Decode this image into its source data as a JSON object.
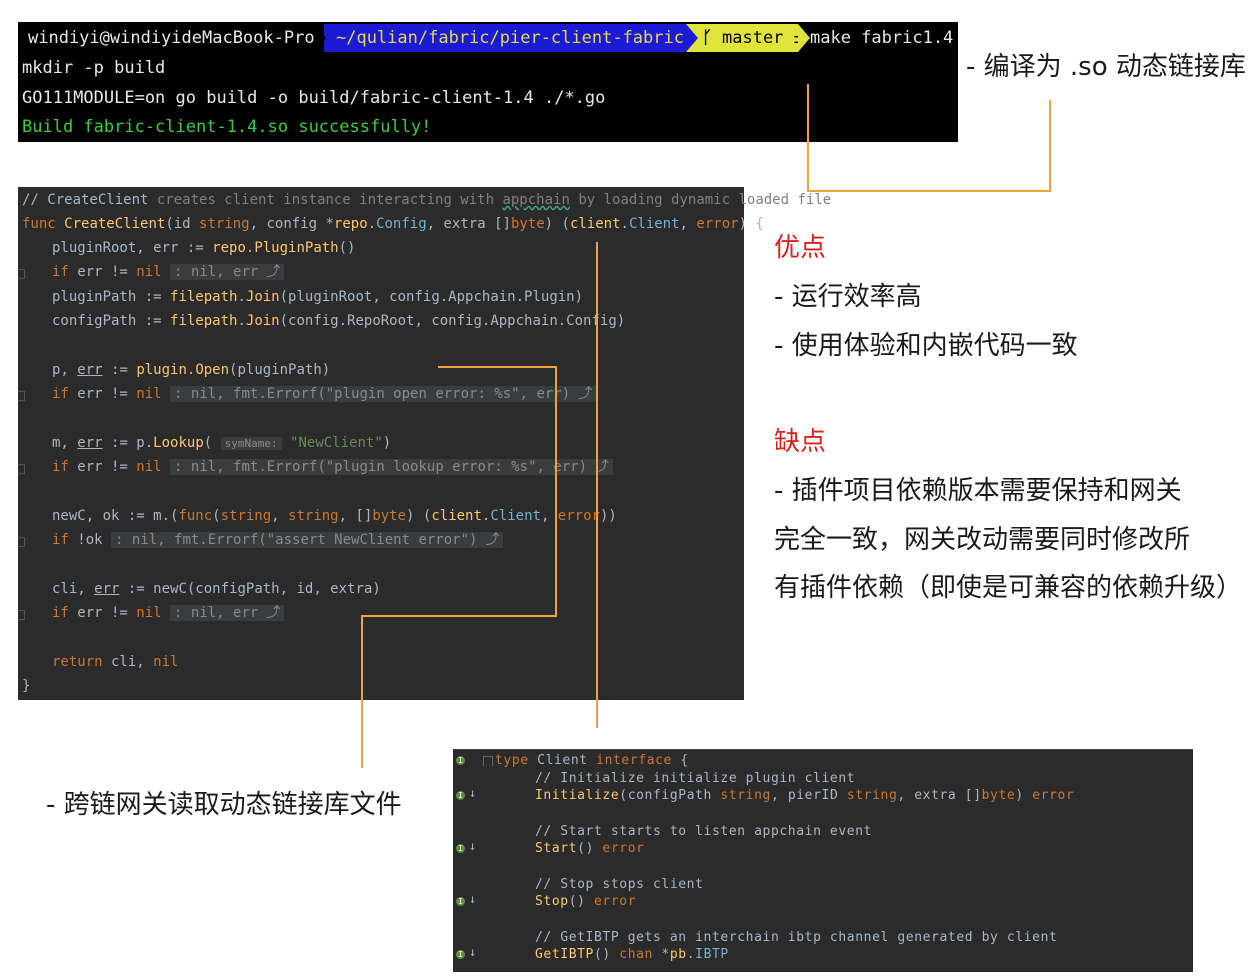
{
  "terminal": {
    "prompt_user": "windiyi@windiyideMacBook-Pro",
    "prompt_path": "~/qulian/fabric/pier-client-fabric",
    "git_branch": "master ±",
    "command": "make fabric1.4",
    "lines": [
      "mkdir -p build",
      "GO111MODULE=on go build -o build/fabric-client-1.4 ./*.go",
      "Build fabric-client-1.4.so successfully!"
    ]
  },
  "ide": {
    "comment_head": "// CreateClient",
    "comment_tail": " creates client instance interacting with ",
    "comment_appchain": "appchain",
    "comment_end": " by loading dynamic loaded file",
    "func_kw": "func ",
    "func_name": "CreateClient",
    "sig": [
      "(id ",
      "string",
      ", config *",
      "repo",
      ".",
      "Config",
      ", extra []",
      "byte",
      ") (",
      "client",
      ".",
      "Client",
      ", ",
      "error",
      ") {"
    ],
    "l_pluginroot": [
      "pluginRoot, err := ",
      "repo",
      ".",
      "PluginPath",
      "()"
    ],
    "l_if": [
      "if",
      " err != ",
      "nil"
    ],
    "l_ifnot": [
      "if",
      " !ok"
    ],
    "hint_nil_err": ": nil, err",
    "hint_open": ": nil, fmt.Errorf(\"plugin open error: %s\", err)",
    "hint_lookup": ": nil, fmt.Errorf(\"plugin lookup error: %s\", err)",
    "hint_assert": ": nil, fmt.Errorf(\"assert NewClient error\")",
    "l_pluginpath": [
      "pluginPath := ",
      "filepath",
      ".",
      "Join",
      "(pluginRoot, config.Appchain.Plugin)"
    ],
    "l_configpath": [
      "configPath := ",
      "filepath",
      ".",
      "Join",
      "(config.RepoRoot, config.Appchain.Config)"
    ],
    "l_open": [
      "p, ",
      "err",
      " := ",
      "plugin",
      ".",
      "Open",
      "(pluginPath)"
    ],
    "l_lookup": [
      "m, ",
      "err",
      " := p.",
      "Lookup",
      "( ",
      "symName:",
      " ",
      "\"NewClient\"",
      ")"
    ],
    "l_newc": [
      "newC, ok := m.(",
      "func",
      "(",
      "string",
      ", ",
      "string",
      ", []",
      "byte",
      ") (",
      "client",
      ".",
      "Client",
      ", ",
      "error",
      "))"
    ],
    "l_cli": [
      "cli, ",
      "err",
      " := newC(configPath, id, extra)"
    ],
    "l_return": [
      "return",
      " cli, ",
      "nil"
    ],
    "close_brace": "}"
  },
  "iface": {
    "type_kw": "type",
    "type_name": " Client ",
    "iface_kw": "interface",
    "open_brace": " {",
    "c1": "// Initialize initialize plugin client",
    "m1": [
      "Initialize",
      "(configPath ",
      "string",
      ", pierID ",
      "string",
      ", extra []",
      "byte",
      ") ",
      "error"
    ],
    "c2": "// Start starts to listen appchain event",
    "m2": [
      "Start",
      "() ",
      "error"
    ],
    "c3": "// Stop stops client",
    "m3": [
      "Stop",
      "() ",
      "error"
    ],
    "c4": "// GetIBTP gets an interchain ibtp channel generated by client",
    "m4": [
      "GetIBTP",
      "() ",
      "chan",
      " *",
      "pb",
      ".",
      "IBTP"
    ],
    "badge_label": "I",
    "arrow_glyph": "↓"
  },
  "annotations": {
    "compile": "- 编译为 .so 动态链接库",
    "pros_title": "优点",
    "pros_1": "- 运行效率高",
    "pros_2": "- 使用体验和内嵌代码一致",
    "cons_title": "缺点",
    "cons_1": "- 插件项目依赖版本需要保持和网关",
    "cons_2": "完全一致，网关改动需要同时修改所",
    "cons_3": "有插件依赖（即使是可兼容的依赖升级）",
    "load": "- 跨链网关读取动态链接库文件"
  },
  "colors": {
    "terminal_bg": "#000000",
    "path_bg": "#1b1bd6",
    "path_fg": "#e8d84a",
    "git_bg": "#dfe33a",
    "success_green": "#3ccc3c",
    "ide_bg": "#2b2b2b",
    "connector": "#f0a238",
    "cons_red": "#d8231c"
  }
}
